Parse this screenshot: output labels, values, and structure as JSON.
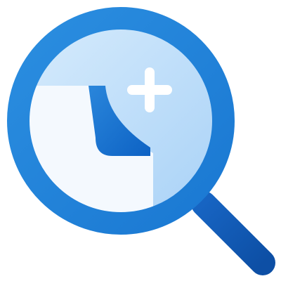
{
  "icon": {
    "name": "search-new-document-icon",
    "colors": {
      "ring": "#1a78d2",
      "ring_light": "#2b8ee0",
      "lens_fill": "#a9d2f7",
      "lens_fill_light": "#d6ebfc",
      "document": "#f4f9fe",
      "document_fold": "#0d62c4",
      "document_fold_light": "#2a86db",
      "plus": "#ffffff",
      "handle": "#0d4fa5",
      "handle_light": "#1764c2"
    }
  }
}
